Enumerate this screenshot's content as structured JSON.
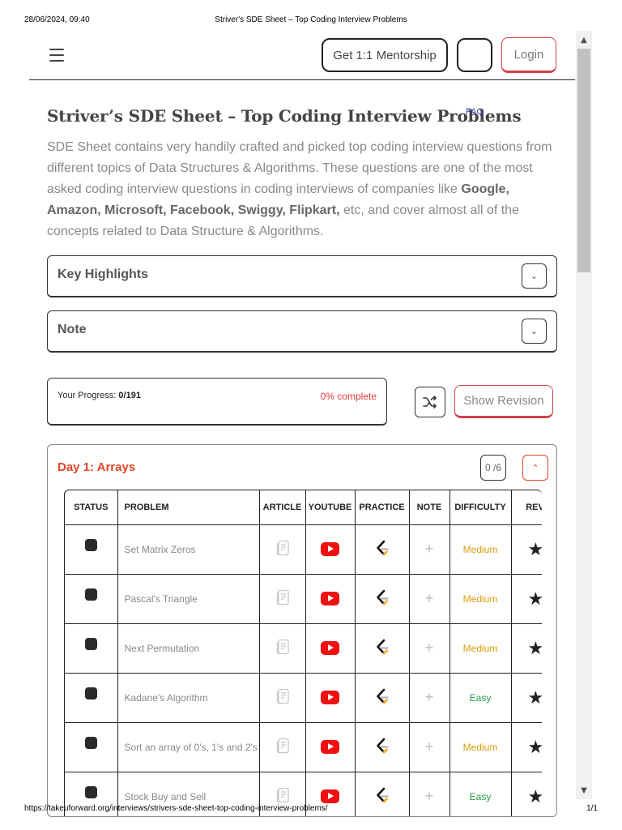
{
  "print": {
    "datetime": "28/06/2024, 09:40",
    "doc_title": "Striver's SDE Sheet – Top Coding Interview Problems",
    "url": "https://takeuforward.org/interviews/strivers-sde-sheet-top-coding-interview-problems/",
    "page": "1/1"
  },
  "nav": {
    "mentorship_label": "Get 1:1 Mentorship",
    "login_label": "Login"
  },
  "page": {
    "title": "Striver’s SDE Sheet – Top Coding Interview Problems",
    "faq": "FAQ",
    "desc_1": "SDE Sheet contains very handily crafted and picked top coding interview questions from different topics of Data Structures & Algorithms. These questions are one of the most asked coding interview questions in coding interviews of companies like ",
    "desc_companies": "Google, Amazon, Microsoft, Facebook, Swiggy, Flipkart,",
    "desc_2": " etc, and cover almost all of the concepts related to Data Structure & Algorithms."
  },
  "accordions": {
    "key_highlights": "Key Highlights",
    "note": "Note"
  },
  "progress": {
    "label": "Your Progress: ",
    "value": "0/191",
    "percent_text": "0% complete",
    "show_revision": "Show Revision"
  },
  "day": {
    "title": "Day 1: Arrays",
    "count": "0 /6"
  },
  "table": {
    "headers": {
      "status": "STATUS",
      "problem": "PROBLEM",
      "article": "ARTICLE",
      "youtube": "YOUTUBE",
      "practice": "PRACTICE",
      "note": "NOTE",
      "difficulty": "DIFFICULTY",
      "revision": "REVISION"
    },
    "rows": [
      {
        "problem": "Set Matrix Zeros",
        "difficulty": "Medium"
      },
      {
        "problem": "Pascal's Triangle",
        "difficulty": "Medium"
      },
      {
        "problem": "Next Permutation",
        "difficulty": "Medium"
      },
      {
        "problem": "Kadane's Algorithm",
        "difficulty": "Easy"
      },
      {
        "problem": "Sort an array of 0's, 1's and 2's",
        "difficulty": "Medium"
      },
      {
        "problem": "Stock Buy and Sell",
        "difficulty": "Easy"
      }
    ]
  },
  "colors": {
    "accent_red": "#e0452b",
    "medium": "#d99b0b",
    "easy": "#2a9d45",
    "youtube": "#ee1111"
  },
  "icons": {
    "menu": "hamburger-icon",
    "shuffle": "shuffle-icon",
    "chevron_down": "chevron-down-icon",
    "chevron_up": "chevron-up-icon",
    "article": "article-icon",
    "youtube": "youtube-icon",
    "practice": "leetcode-icon",
    "note": "plus-icon",
    "revision": "star-icon"
  }
}
